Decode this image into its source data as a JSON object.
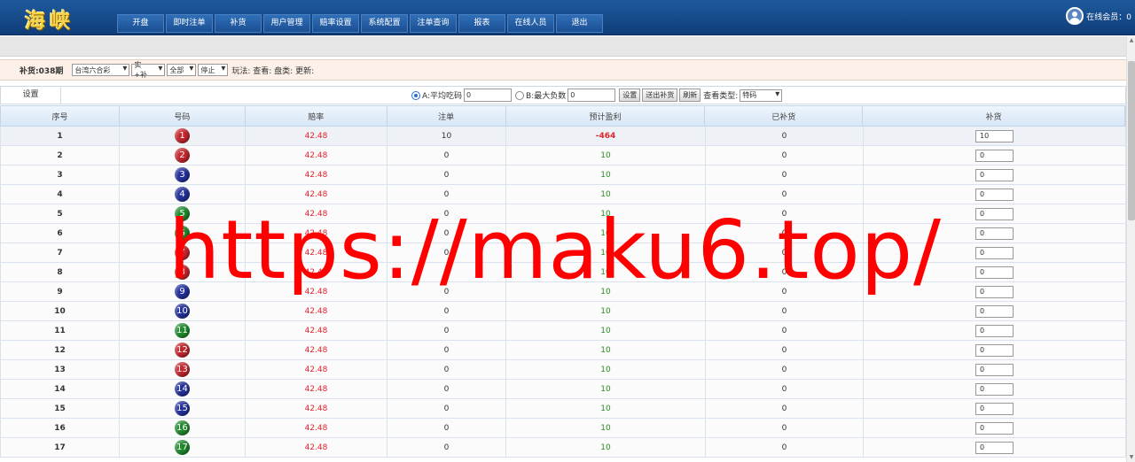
{
  "header": {
    "logo": "海峡",
    "nav": [
      "开盘",
      "即时注单",
      "补货",
      "用户管理",
      "赔率设置",
      "系统配置",
      "注单查询",
      "报表",
      "在线人员",
      "退出"
    ],
    "online_label": "在线会员：0"
  },
  "filter": {
    "period": "补货:038期",
    "lottery": "台湾六合彩",
    "mode": "实+补",
    "range": "全部",
    "status": "停止",
    "info": "玩法: 查看: 盘类: 更新:"
  },
  "settings": {
    "label": "设置",
    "option_a_label": "A:平均吃码",
    "option_a_value": "0",
    "option_b_label": "B:最大负数",
    "option_b_value": "0",
    "btn_set": "设置",
    "btn_send": "送出补货",
    "btn_refresh": "刷新",
    "view_type_label": "查看类型:",
    "view_type_value": "特码"
  },
  "table": {
    "headers": [
      "序号",
      "号码",
      "赔率",
      "注单",
      "预计盈利",
      "已补货",
      "补货"
    ],
    "rows": [
      {
        "seq": "1",
        "ball": "1",
        "color": "red",
        "odds": "42.48",
        "bets": "10",
        "profit": "-464",
        "filled": "0",
        "supply": "10"
      },
      {
        "seq": "2",
        "ball": "2",
        "color": "red",
        "odds": "42.48",
        "bets": "0",
        "profit": "10",
        "filled": "0",
        "supply": "0"
      },
      {
        "seq": "3",
        "ball": "3",
        "color": "blue",
        "odds": "42.48",
        "bets": "0",
        "profit": "10",
        "filled": "0",
        "supply": "0"
      },
      {
        "seq": "4",
        "ball": "4",
        "color": "blue",
        "odds": "42.48",
        "bets": "0",
        "profit": "10",
        "filled": "0",
        "supply": "0"
      },
      {
        "seq": "5",
        "ball": "5",
        "color": "green",
        "odds": "42.48",
        "bets": "0",
        "profit": "10",
        "filled": "0",
        "supply": "0"
      },
      {
        "seq": "6",
        "ball": "6",
        "color": "green",
        "odds": "42.48",
        "bets": "0",
        "profit": "10",
        "filled": "0",
        "supply": "0"
      },
      {
        "seq": "7",
        "ball": "7",
        "color": "red",
        "odds": "42.48",
        "bets": "0",
        "profit": "10",
        "filled": "0",
        "supply": "0"
      },
      {
        "seq": "8",
        "ball": "8",
        "color": "red",
        "odds": "42.48",
        "bets": "0",
        "profit": "10",
        "filled": "0",
        "supply": "0"
      },
      {
        "seq": "9",
        "ball": "9",
        "color": "blue",
        "odds": "42.48",
        "bets": "0",
        "profit": "10",
        "filled": "0",
        "supply": "0"
      },
      {
        "seq": "10",
        "ball": "10",
        "color": "blue",
        "odds": "42.48",
        "bets": "0",
        "profit": "10",
        "filled": "0",
        "supply": "0"
      },
      {
        "seq": "11",
        "ball": "11",
        "color": "green",
        "odds": "42.48",
        "bets": "0",
        "profit": "10",
        "filled": "0",
        "supply": "0"
      },
      {
        "seq": "12",
        "ball": "12",
        "color": "red",
        "odds": "42.48",
        "bets": "0",
        "profit": "10",
        "filled": "0",
        "supply": "0"
      },
      {
        "seq": "13",
        "ball": "13",
        "color": "red",
        "odds": "42.48",
        "bets": "0",
        "profit": "10",
        "filled": "0",
        "supply": "0"
      },
      {
        "seq": "14",
        "ball": "14",
        "color": "blue",
        "odds": "42.48",
        "bets": "0",
        "profit": "10",
        "filled": "0",
        "supply": "0"
      },
      {
        "seq": "15",
        "ball": "15",
        "color": "blue",
        "odds": "42.48",
        "bets": "0",
        "profit": "10",
        "filled": "0",
        "supply": "0"
      },
      {
        "seq": "16",
        "ball": "16",
        "color": "green",
        "odds": "42.48",
        "bets": "0",
        "profit": "10",
        "filled": "0",
        "supply": "0"
      },
      {
        "seq": "17",
        "ball": "17",
        "color": "green",
        "odds": "42.48",
        "bets": "0",
        "profit": "10",
        "filled": "0",
        "supply": "0"
      }
    ]
  },
  "watermark": "https://maku6.top/",
  "colors": {
    "header": "#1f5a9e",
    "odds": "#e0232b",
    "profit": "#2a8a22",
    "ball_red": "#c4262e",
    "ball_blue": "#23319a",
    "ball_green": "#1f8a2c"
  }
}
